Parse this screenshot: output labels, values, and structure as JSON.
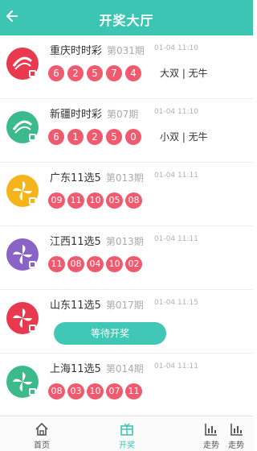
{
  "header": {
    "title": "开奖大厅",
    "back_icon": "back-arrow-icon"
  },
  "colors": {
    "accent": "#3cc5b3",
    "ball": "#f05a6e"
  },
  "lotteries": [
    {
      "name": "重庆时时彩",
      "issue": "第031期",
      "time": "01-04 11:10",
      "numbers": [
        "6",
        "2",
        "5",
        "7",
        "4"
      ],
      "result": "大双 | 无牛",
      "logo_color": "#e8394e"
    },
    {
      "name": "新疆时时彩",
      "issue": "第07期",
      "time": "01-04 11:10",
      "numbers": [
        "6",
        "1",
        "2",
        "5",
        "0"
      ],
      "result": "小双 | 无牛",
      "logo_color": "#3cba8c"
    },
    {
      "name": "广东11选5",
      "issue": "第013期",
      "time": "01-04 11:11",
      "numbers": [
        "09",
        "11",
        "10",
        "05",
        "08"
      ],
      "result": "",
      "logo_color": "#f4b41a"
    },
    {
      "name": "江西11选5",
      "issue": "第013期",
      "time": "01-04 11:11",
      "numbers": [
        "11",
        "08",
        "04",
        "10",
        "02"
      ],
      "result": "",
      "logo_color": "#8a63c7"
    },
    {
      "name": "山东11选5",
      "issue": "第017期",
      "time": "01-04 11:15",
      "numbers": [],
      "result": "",
      "button": "等待开奖",
      "logo_color": "#e8394e"
    },
    {
      "name": "上海11选5",
      "issue": "第014期",
      "time": "01-04 11:11",
      "numbers": [
        "08",
        "03",
        "10",
        "07",
        "11"
      ],
      "result": "",
      "logo_color": "#3cba8c"
    }
  ],
  "tabbar": {
    "items": [
      {
        "label": "首页",
        "icon": "home-icon"
      },
      {
        "label": "开奖",
        "icon": "lottery-icon"
      },
      {
        "label": "走势",
        "icon": "trend-chart-icon"
      },
      {
        "label": "走势",
        "icon": "trend-chart-icon"
      }
    ]
  }
}
